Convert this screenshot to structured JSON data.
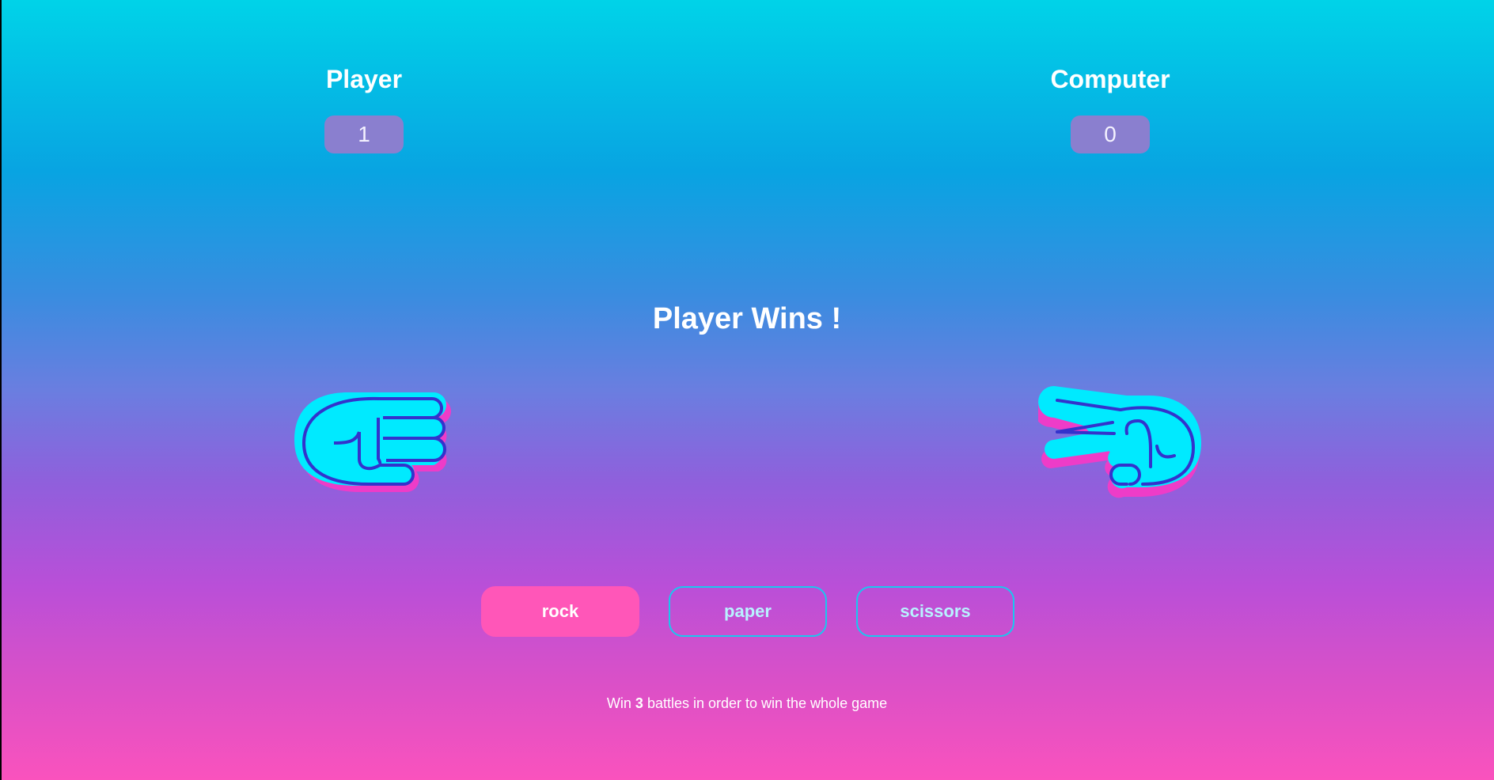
{
  "scoreboard": {
    "player_label": "Player",
    "player_score": "1",
    "computer_label": "Computer",
    "computer_score": "0"
  },
  "result": {
    "message": "Player Wins !"
  },
  "hands": {
    "player": "rock-hand-icon",
    "computer": "scissors-hand-icon"
  },
  "choices": [
    {
      "label": "rock",
      "state": "selected"
    },
    {
      "label": "paper",
      "state": "default"
    },
    {
      "label": "scissors",
      "state": "default"
    }
  ],
  "hint": {
    "prefix": "Win",
    "target": "3",
    "suffix": "battles in order to win the whole game"
  },
  "colors": {
    "hand_fill": "#00eaff",
    "hand_stroke": "#3333cc",
    "hand_shadow": "#ee3cc8",
    "selected_button": "#ff56b8",
    "outline_button": "#19c8ef",
    "score_box": "#8a7fcf"
  }
}
